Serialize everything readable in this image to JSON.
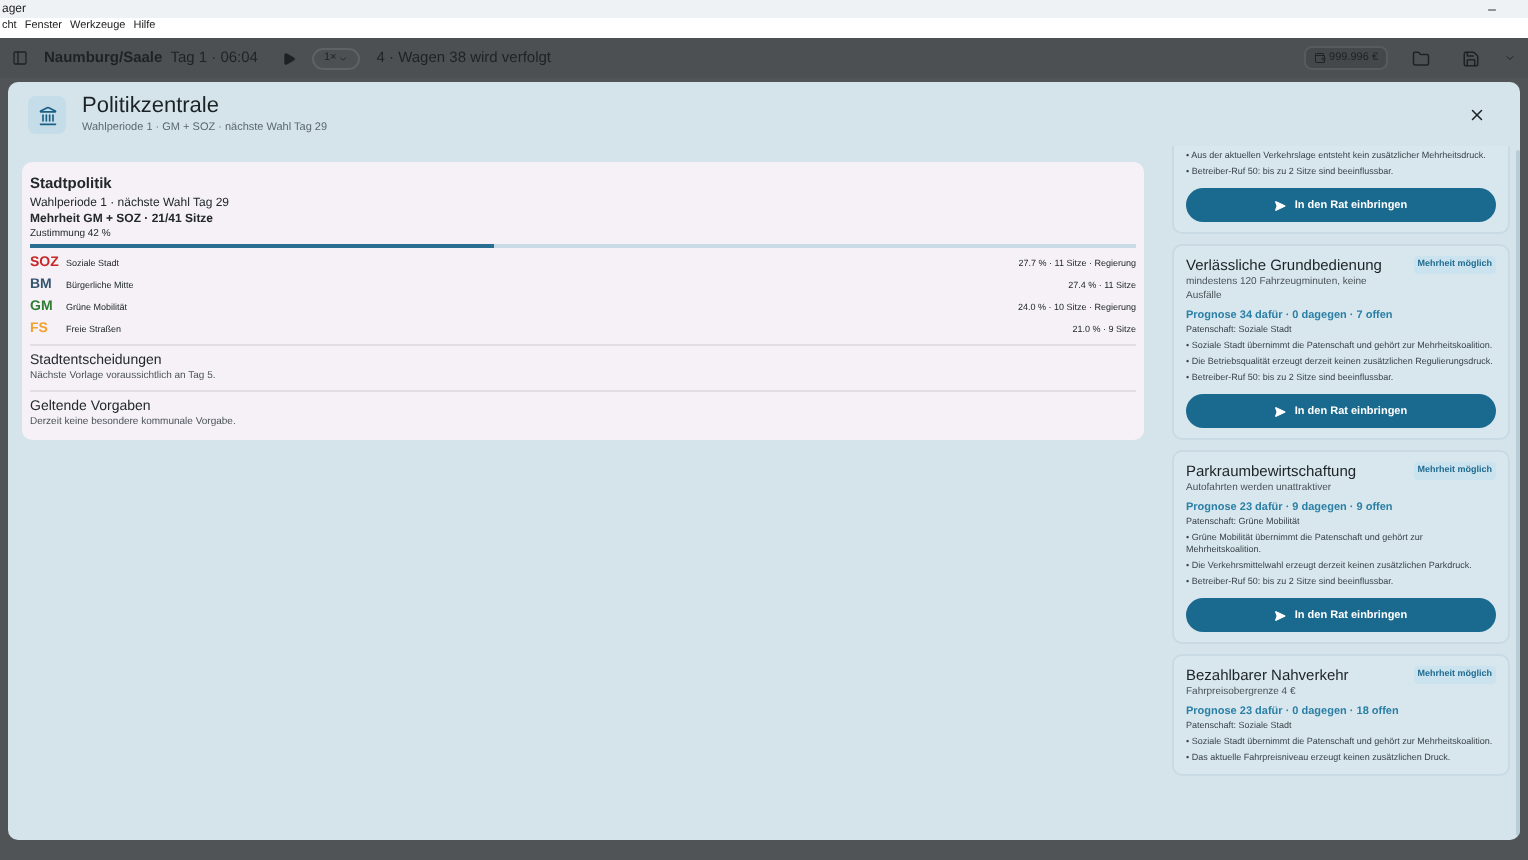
{
  "app_window": {
    "title": "ager",
    "menu": [
      "cht",
      "Fenster",
      "Werkzeuge",
      "Hilfe"
    ]
  },
  "toolbar": {
    "city": "Naumburg/Saale",
    "time": "Tag 1 · 06:04",
    "speed": "1×",
    "status": "4 · Wagen 38 wird verfolgt",
    "balance": "999.996 €"
  },
  "dialog": {
    "title": "Politikzentrale",
    "subtitle": "Wahlperiode 1 · GM + SOZ · nächste Wahl Tag 29"
  },
  "city_politics": {
    "title": "Stadtpolitik",
    "lines": [
      "Wahlperiode 1 · nächste Wahl Tag 29",
      "Mehrheit GM + SOZ · 21/41 Sitze"
    ],
    "approval": {
      "label": "Zustimmung 42 %",
      "level": 0.42
    },
    "parties": [
      {
        "abbr": "SOZ",
        "name": "Soziale Stadt",
        "stats": "27.7 % · 11 Sitze · Regierung",
        "color": "#c62828"
      },
      {
        "abbr": "BM",
        "name": "Bürgerliche Mitte",
        "stats": "27.4 % · 11 Sitze",
        "color": "#37556f"
      },
      {
        "abbr": "GM",
        "name": "Grüne Mobilität",
        "stats": "24.0 % · 10 Sitze · Regierung",
        "color": "#2e7d32"
      },
      {
        "abbr": "FS",
        "name": "Freie Straßen",
        "stats": "21.0 % · 9 Sitze",
        "color": "#f2a231"
      }
    ]
  },
  "sections": [
    {
      "title": "Stadtentscheidungen",
      "text": "Nächste Vorlage voraussichtlich an Tag 5."
    },
    {
      "title": "Geltende Vorgaben",
      "text": "Derzeit keine besondere kommunale Vorgabe."
    }
  ],
  "proposals": [
    {
      "bullets": [
        "• Aus der aktuellen Verkehrslage entsteht kein zusätzlicher Mehrheitsdruck.",
        "• Betreiber-Ruf 50: bis zu 2 Sitze sind beeinflussbar."
      ],
      "button": "In den Rat einbringen"
    },
    {
      "title": "Verlässliche Grundbedienung",
      "badge": "Mehrheit möglich",
      "subtitle": "mindestens 120 Fahrzeugminuten, keine Ausfälle",
      "forecast": "Prognose 34 dafür · 0 dagegen · 7 offen",
      "sponsor": "Patenschaft: Soziale Stadt",
      "bullets": [
        "• Soziale Stadt übernimmt die Patenschaft und gehört zur Mehrheitskoalition.",
        "• Die Betriebsqualität erzeugt derzeit keinen zusätzlichen Regulierungsdruck.",
        "• Betreiber-Ruf 50: bis zu 2 Sitze sind beeinflussbar."
      ],
      "button": "In den Rat einbringen"
    },
    {
      "title": "Parkraumbewirtschaftung",
      "badge": "Mehrheit möglich",
      "subtitle": "Autofahrten werden unattraktiver",
      "forecast": "Prognose 23 dafür · 9 dagegen · 9 offen",
      "sponsor": "Patenschaft: Grüne Mobilität",
      "bullets": [
        "• Grüne Mobilität übernimmt die Patenschaft und gehört zur Mehrheitskoalition.",
        "• Die Verkehrsmittelwahl erzeugt derzeit keinen zusätzlichen Parkdruck.",
        "• Betreiber-Ruf 50: bis zu 2 Sitze sind beeinflussbar."
      ],
      "button": "In den Rat einbringen"
    },
    {
      "title": "Bezahlbarer Nahverkehr",
      "badge": "Mehrheit möglich",
      "subtitle": "Fahrpreisobergrenze 4 €",
      "forecast": "Prognose 23 dafür · 0 dagegen · 18 offen",
      "sponsor": "Patenschaft: Soziale Stadt",
      "bullets": [
        "• Soziale Stadt übernimmt die Patenschaft und gehört zur Mehrheitskoalition.",
        "• Das aktuelle Fahrpreisniveau erzeugt keinen zusätzlichen Druck."
      ]
    }
  ]
}
